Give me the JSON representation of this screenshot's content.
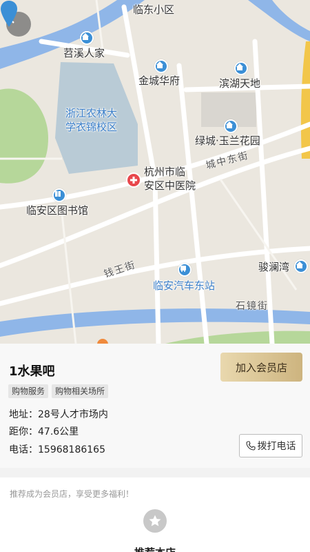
{
  "map": {
    "labels": {
      "linDongXiaoQu": "临东小区",
      "tiaoxiRenJia": "苕溪人家",
      "jinchengHuaFu": "金城华府",
      "binhuTianDi": "滨湖天地",
      "zjUniversity": "浙江农林大\n学衣锦校区",
      "lvchengYulan": "绿城·玉兰花园",
      "chengZhongDongJie": "城中东街",
      "hospital": "杭州市临\n安区中医院",
      "library": "临安区图书馆",
      "qianwangJie": "钱王街",
      "junlanWan": "骏澜湾",
      "busStation": "临安汽车东站",
      "shijingJie": "石镜街"
    }
  },
  "store": {
    "name": "1水果吧",
    "join_label": "加入会员店",
    "tags": [
      "购物服务",
      "购物相关场所"
    ],
    "address_key": "地址：",
    "address_value": "28号人才市场内",
    "distance_key": "距你：",
    "distance_value": "47.6公里",
    "phone_key": "电话：",
    "phone_value": "15968186165",
    "call_label": "拨打电话"
  },
  "promo": {
    "text": "推荐成为会员店，享受更多福利！",
    "recommend_label": "推荐本店"
  },
  "colors": {
    "map_bg": "#ebe7df",
    "water": "#8fb6e8",
    "campus": "#b9cbd6",
    "park": "#b6d79a",
    "pin": "#3b8fd6",
    "gold_start": "#e9d8ae",
    "gold_end": "#cdb47f"
  }
}
